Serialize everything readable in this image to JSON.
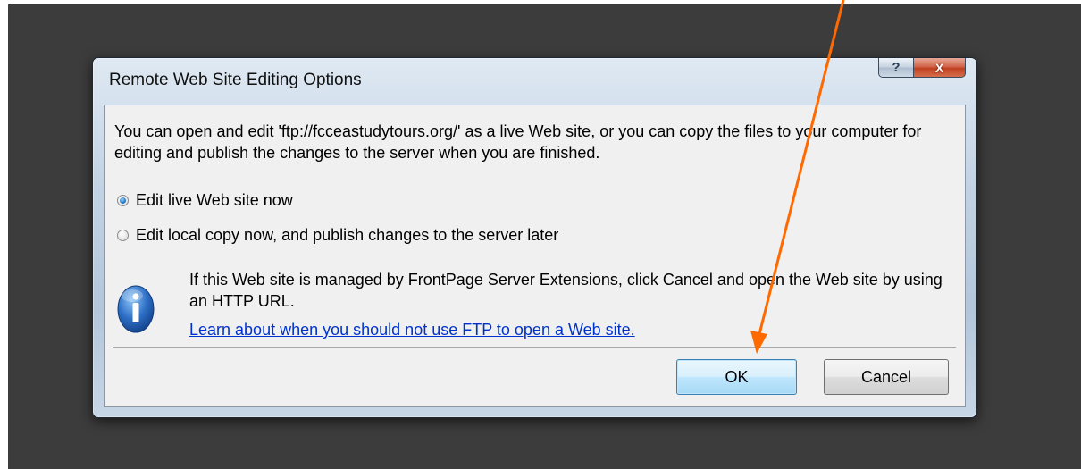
{
  "dialog": {
    "title": "Remote Web Site Editing Options",
    "help_glyph": "?",
    "close_glyph": "X",
    "message": "You can open and edit 'ftp://fcceastudytours.org/' as a live Web site, or you can copy the files to your computer for editing and publish the changes to the server when you are finished.",
    "options": [
      {
        "label": "Edit live Web site now",
        "selected": true
      },
      {
        "label": "Edit local copy now, and publish changes to the server later",
        "selected": false
      }
    ],
    "info_icon": "info-icon",
    "note": "If this Web site is managed by FrontPage Server Extensions, click Cancel and open the Web site by using an HTTP URL.",
    "link_text": "Learn about when you should not use FTP to open a Web site.",
    "buttons": {
      "ok": "OK",
      "cancel": "Cancel"
    }
  },
  "annotation": {
    "arrow_color": "#ff6a00",
    "points_to": "ok-button"
  }
}
